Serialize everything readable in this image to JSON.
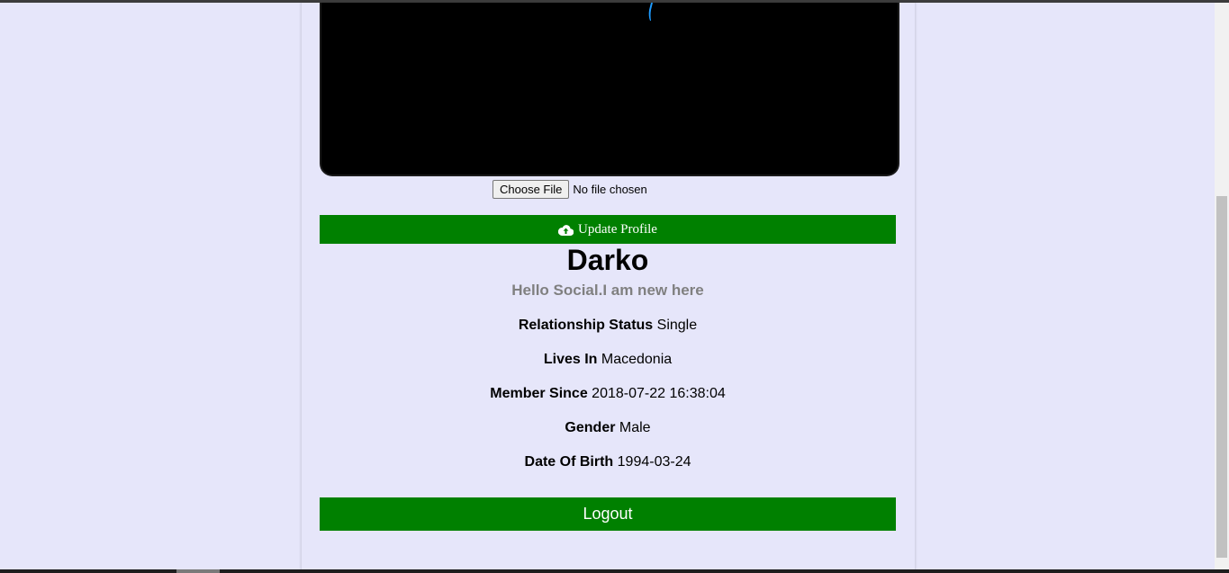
{
  "profile": {
    "file_input": {
      "button_label": "Choose File",
      "status_text": "No file chosen"
    },
    "update_button_label": "Update Profile",
    "update_icon": "cloud-upload-icon",
    "name": "Darko",
    "bio": "Hello Social.I am new here",
    "details": [
      {
        "label": "Relationship Status",
        "value": "Single"
      },
      {
        "label": "Lives In",
        "value": "Macedonia"
      },
      {
        "label": "Member Since",
        "value": "2018-07-22 16:38:04"
      },
      {
        "label": "Gender",
        "value": "Male"
      },
      {
        "label": "Date Of Birth",
        "value": "1994-03-24"
      }
    ],
    "logout_label": "Logout"
  },
  "colors": {
    "page_background": "#e6e6fa",
    "button_green": "#008000",
    "bio_gray": "#808080"
  }
}
